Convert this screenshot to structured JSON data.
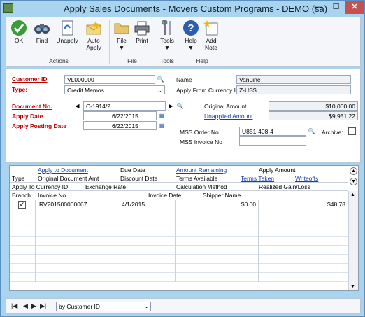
{
  "window": {
    "title": "Apply Sales Documents  -  Movers Custom Programs  -  DEMO (sa)"
  },
  "ribbon": {
    "buttons": [
      {
        "key": "ok",
        "label": "OK"
      },
      {
        "key": "find",
        "label": "Find"
      },
      {
        "key": "unapply",
        "label": "Unapply"
      },
      {
        "key": "auto_apply",
        "label": "Auto Apply"
      },
      {
        "key": "file",
        "label": "File"
      },
      {
        "key": "print",
        "label": "Print"
      },
      {
        "key": "tools",
        "label": "Tools"
      },
      {
        "key": "help",
        "label": "Help"
      },
      {
        "key": "add_note",
        "label": "Add Note"
      }
    ],
    "groups": {
      "actions": "Actions",
      "file": "File",
      "tools": "Tools",
      "help": "Help"
    }
  },
  "header": {
    "customer_id_label": "Customer ID",
    "customer_id": "VL000000",
    "type_label": "Type:",
    "type_value": "Credit Memos",
    "name_label": "Name",
    "name_value": "VanLine",
    "currency_label": "Apply From Currency ID",
    "currency_value": "Z-US$",
    "document_no_label": "Document No.",
    "document_no": "C-1914/2",
    "apply_date_label": "Apply Date",
    "apply_date": "6/22/2015",
    "apply_posting_date_label": "Apply Posting Date",
    "apply_posting_date": "6/22/2015",
    "original_amount_label": "Original Amount",
    "original_amount": "$10,000.00",
    "unapplied_amount_label": "Unapplied Amount",
    "unapplied_amount": "$9,951.22",
    "mss_order_label": "MSS Order No",
    "mss_order_value": "U851-408-4",
    "archive_label": "Archive:",
    "mss_invoice_label": "MSS Invoice No",
    "mss_invoice_value": ""
  },
  "grid": {
    "header_rows": [
      [
        "",
        "Apply to Document",
        "Due Date",
        "Amount Remaining",
        "Apply Amount"
      ],
      [
        "Type",
        "Original Document Amt",
        "Discount Date",
        "Terms Available",
        "Terms Taken",
        "Writeoffs"
      ],
      [
        "Apply To Currency ID",
        "Exchange Rate",
        "Calculation Method",
        "Realized Gain/Loss"
      ],
      [
        "Branch",
        "Invoice No",
        "Invoice Date",
        "Shipper Name"
      ]
    ],
    "rows": [
      {
        "checked": true,
        "invoice_no": "RV201500000067",
        "invoice_date": "4/1/2015",
        "shipper_name": "$0.00",
        "amount": "$48.78"
      }
    ]
  },
  "footer": {
    "sort_by": "by Customer ID"
  },
  "colors": {
    "required": "#c00000",
    "link": "#1a3fb0",
    "accent": "#a9d4f0"
  }
}
